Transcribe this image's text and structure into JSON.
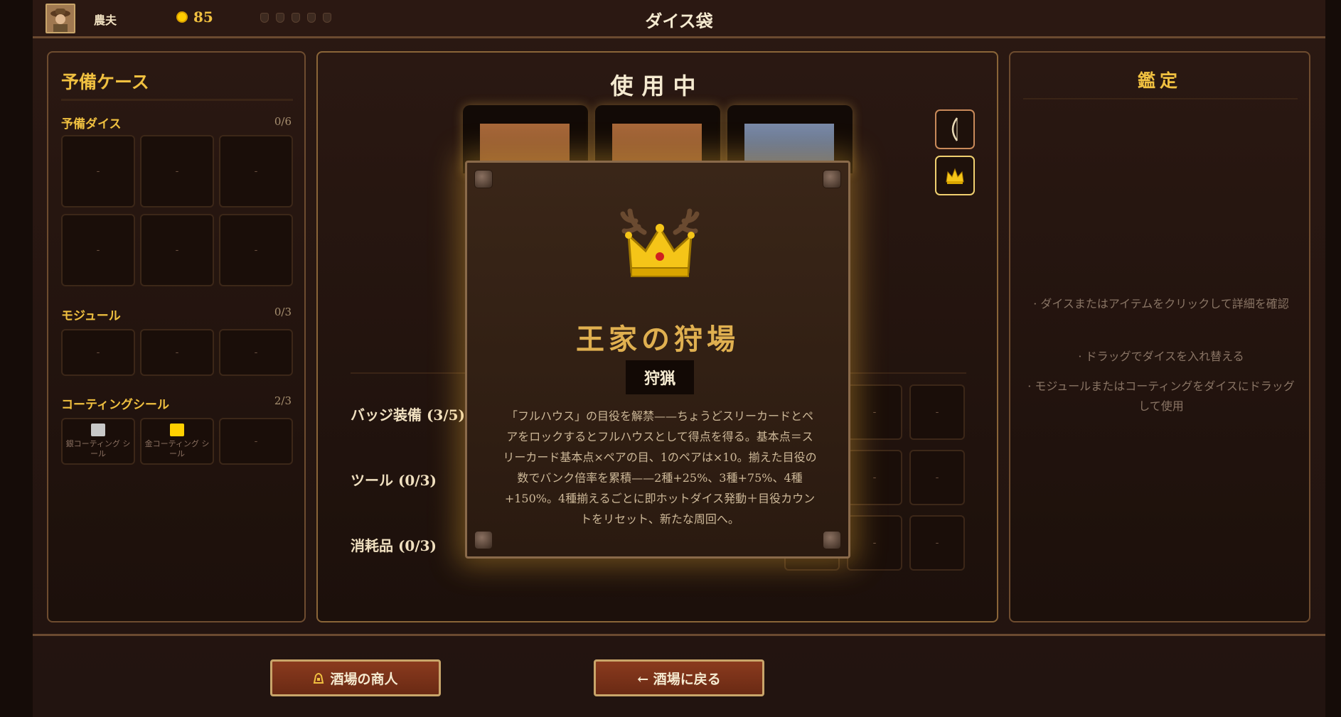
{
  "header": {
    "player_name": "農夫",
    "coins": "85",
    "title": "ダイス袋"
  },
  "left": {
    "title": "予備ケース",
    "spare_dice": {
      "label": "予備ダイス",
      "count": "0/6",
      "slots": [
        "-",
        "-",
        "-",
        "-",
        "-",
        "-"
      ]
    },
    "modules": {
      "label": "モジュール",
      "count": "0/3",
      "slots": [
        "-",
        "-",
        "-"
      ]
    },
    "coating": {
      "label": "コーティングシール",
      "count": "2/3",
      "silver": "銀コーティング シール",
      "gold": "金コーティング シール",
      "empty": "-"
    }
  },
  "center": {
    "title": "使用中",
    "badges_label": "バッジ装備 (3/5)",
    "tools_label": "ツール (0/3)",
    "consumables_label": "消耗品 (0/3)",
    "slot_empty": "-"
  },
  "modal": {
    "title": "王家の狩場",
    "tag": "狩猟",
    "description": "「フルハウス」の目役を解禁——ちょうどスリーカードとペアをロックするとフルハウスとして得点を得る。基本点＝スリーカード基本点×ペアの目、1のペアは×10。揃えた目役の数でバンク倍率を累積——2種+25%、3種+75%、4種+150%。4種揃えるごとに即ホットダイス発動＋目役カウントをリセット、新たな周回へ。"
  },
  "right": {
    "title": "鑑定",
    "hints": [
      "· ダイスまたはアイテムをクリックして詳細を確認",
      "· ドラッグでダイスを入れ替える",
      "· モジュールまたはコーティングをダイスにドラッグして使用"
    ]
  },
  "footer": {
    "merchant_button": "酒場の商人",
    "back_button": "← 酒場に戻る"
  },
  "colors": {
    "accent_gold": "#f0c040",
    "button_red": "#7a3018",
    "panel_border": "#6e4c2f"
  }
}
